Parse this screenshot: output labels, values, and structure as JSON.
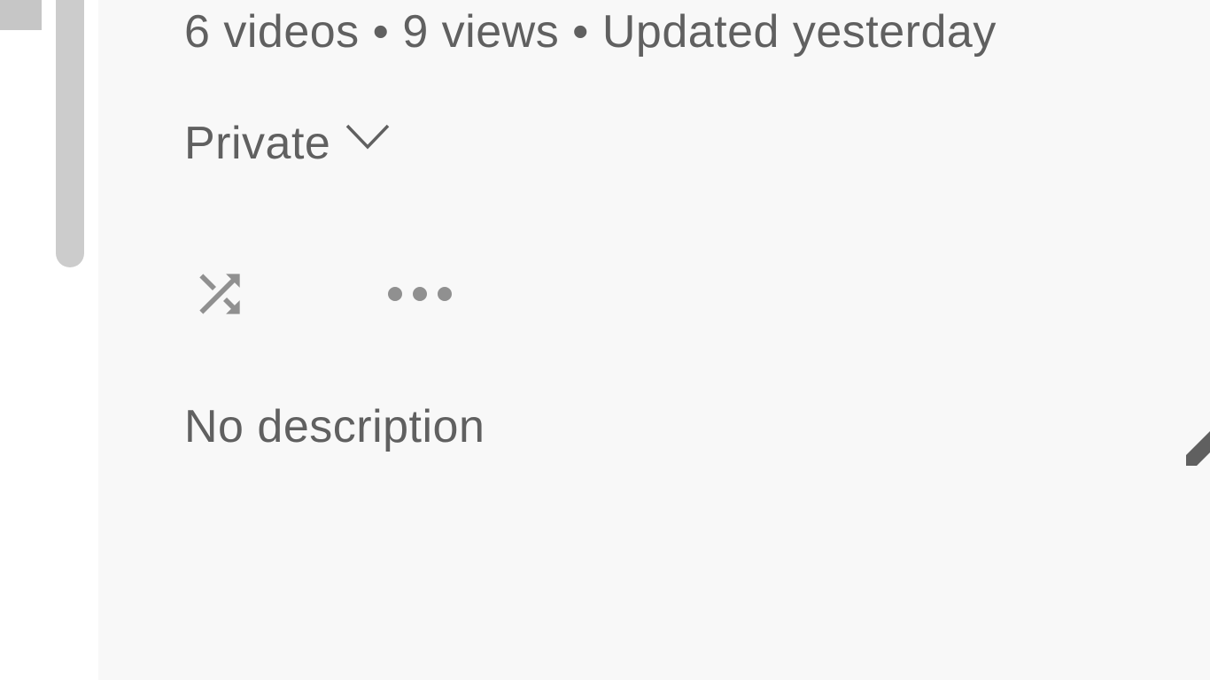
{
  "playlist": {
    "stats": {
      "video_count": "6 videos",
      "separator_1": "•",
      "view_count": "9 views",
      "separator_2": "•",
      "updated": "Updated yesterday"
    },
    "privacy": {
      "label": "Private",
      "icon": "chevron-down-icon"
    },
    "actions": {
      "shuffle_icon": "shuffle-icon",
      "more_icon": "more-horizontal-icon"
    },
    "description": "No description",
    "edit_icon": "pencil-icon"
  },
  "colors": {
    "panel_background": "#f8f8f8",
    "text": "#606060",
    "icon": "#909090",
    "edit_icon": "#606060",
    "scrollbar": "#cccccc"
  }
}
